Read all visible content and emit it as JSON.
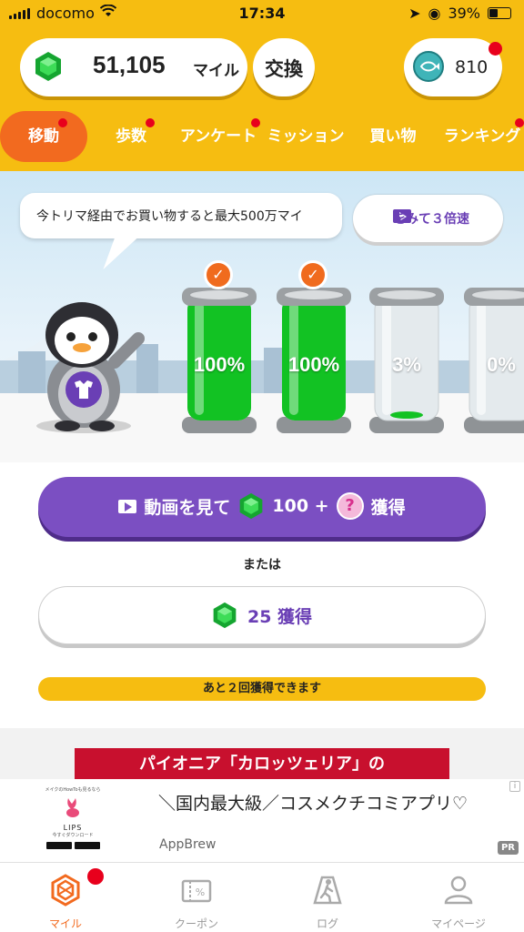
{
  "status_bar": {
    "carrier": "docomo",
    "time": "17:34",
    "battery": "39%"
  },
  "header": {
    "miles_value": "51,105",
    "miles_unit": "マイル",
    "exchange_label": "交換",
    "coins_value": "810"
  },
  "tabs": [
    {
      "label": "移動",
      "active": true
    },
    {
      "label": "歩数"
    },
    {
      "label": "アンケート"
    },
    {
      "label": "ミッション"
    },
    {
      "label": "買い物"
    },
    {
      "label": "ランキング"
    }
  ],
  "hero": {
    "speech": "今トリマ経由でお買い物すると最大500万マイ",
    "video_button": "をみて３倍速",
    "tubes": [
      {
        "percent": "100%",
        "fill": 1.0,
        "checked": true
      },
      {
        "percent": "100%",
        "fill": 1.0,
        "checked": true
      },
      {
        "percent": "3%",
        "fill": 0.03,
        "checked": false
      },
      {
        "percent": "0%",
        "fill": 0.0,
        "checked": false
      }
    ]
  },
  "actions": {
    "watch_prefix": "動画を見て",
    "watch_amount": "100 +",
    "watch_suffix": "獲得",
    "or_text": "または",
    "get_label": "25 獲得",
    "remaining": "あと２回獲得できます"
  },
  "banner": {
    "text": "パイオニア「カロッツェリア」の"
  },
  "ad": {
    "logo_tagline": "メイクのHowToも見るなら",
    "logo_name": "LIPS",
    "logo_sub": "今すぐダウンロード",
    "title": "＼国内最大級／コスメクチコミアプリ♡",
    "brand": "AppBrew",
    "pr": "PR",
    "info": "i"
  },
  "bottom_nav": [
    {
      "label": "マイル",
      "icon": "miles-hex-icon",
      "active": true
    },
    {
      "label": "クーポン",
      "icon": "coupon-icon"
    },
    {
      "label": "ログ",
      "icon": "walking-log-icon"
    },
    {
      "label": "マイページ",
      "icon": "person-icon"
    }
  ],
  "colors": {
    "brand_yellow": "#f6bd11",
    "accent_orange": "#f26a1f",
    "purple": "#7b4fc2",
    "gem_green": "#1fc23c",
    "notify_red": "#e8001c"
  }
}
